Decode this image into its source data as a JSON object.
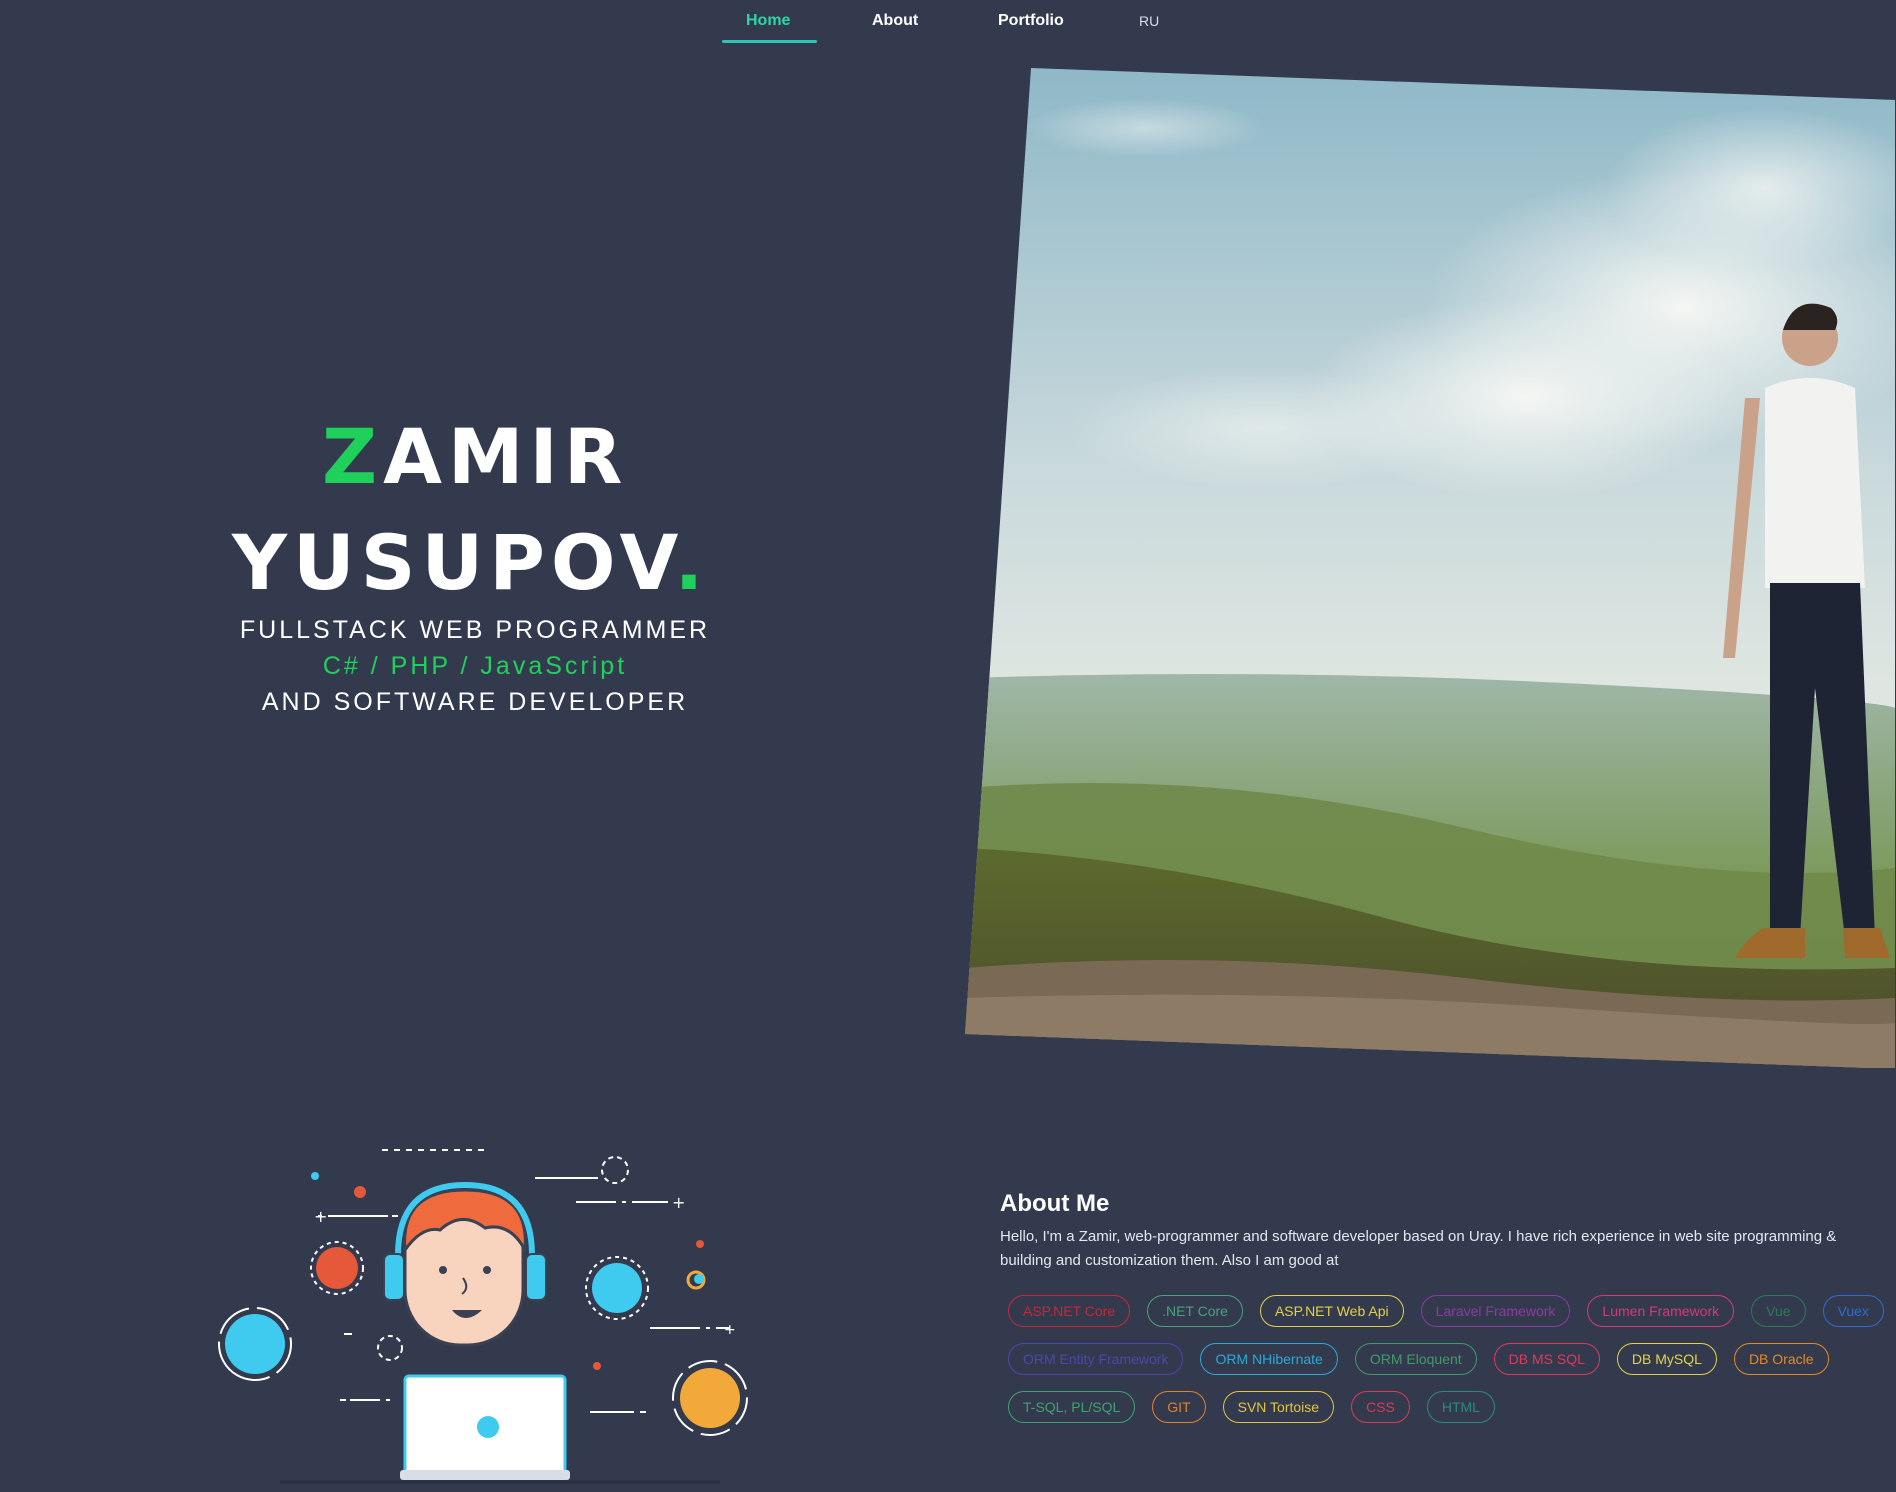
{
  "nav": {
    "items": [
      {
        "label": "Home",
        "active": true
      },
      {
        "label": "About"
      },
      {
        "label": "Portfolio"
      }
    ],
    "lang": "RU"
  },
  "hero": {
    "first_name_initial": "Z",
    "first_name_rest": "AMIR",
    "last_name": "YUSUPOV",
    "last_name_dot": ".",
    "line1": "FULLSTACK WEB PROGRAMMER",
    "line2": "C# / PHP / JavaScript",
    "line3": "AND SOFTWARE DEVELOPER"
  },
  "about": {
    "title": "About Me",
    "text": "Hello, I'm a Zamir, web-programmer and software developer based on Uray. I have rich experience in web site programming & building and customization them. Also I am good at",
    "tag_rows": [
      [
        {
          "label": "ASP.NET Core",
          "color": "#c6283b"
        },
        {
          "label": ".NET Core",
          "color": "#4aa27a"
        },
        {
          "label": "ASP.NET Web Api",
          "color": "#e3cf4c"
        },
        {
          "label": "Laravel Framework",
          "color": "#8a3c9f"
        },
        {
          "label": "Lumen Framework",
          "color": "#d43a78"
        },
        {
          "label": "Vue",
          "color": "#2e7a56"
        },
        {
          "label": "Vuex",
          "color": "#2f6bd1"
        }
      ],
      [
        {
          "label": "ORM Entity Framework",
          "color": "#4b48a8"
        },
        {
          "label": "ORM NHibernate",
          "color": "#2fa8d6"
        },
        {
          "label": "ORM Eloquent",
          "color": "#3f9a6c"
        },
        {
          "label": "DB MS SQL",
          "color": "#dc3a5b"
        },
        {
          "label": "DB MySQL",
          "color": "#e1d24b"
        },
        {
          "label": "DB Oracle",
          "color": "#e48a25"
        }
      ],
      [
        {
          "label": "T-SQL, PL/SQL",
          "color": "#3fa270"
        },
        {
          "label": "GIT",
          "color": "#e0822b"
        },
        {
          "label": "SVN Tortoise",
          "color": "#e2c443"
        },
        {
          "label": "CSS",
          "color": "#d93a54"
        },
        {
          "label": "HTML",
          "color": "#2c8a7e"
        }
      ]
    ]
  },
  "colors": {
    "background": "#333a4e",
    "accent_green": "#1fd15a",
    "nav_active": "#2ed6a6"
  }
}
